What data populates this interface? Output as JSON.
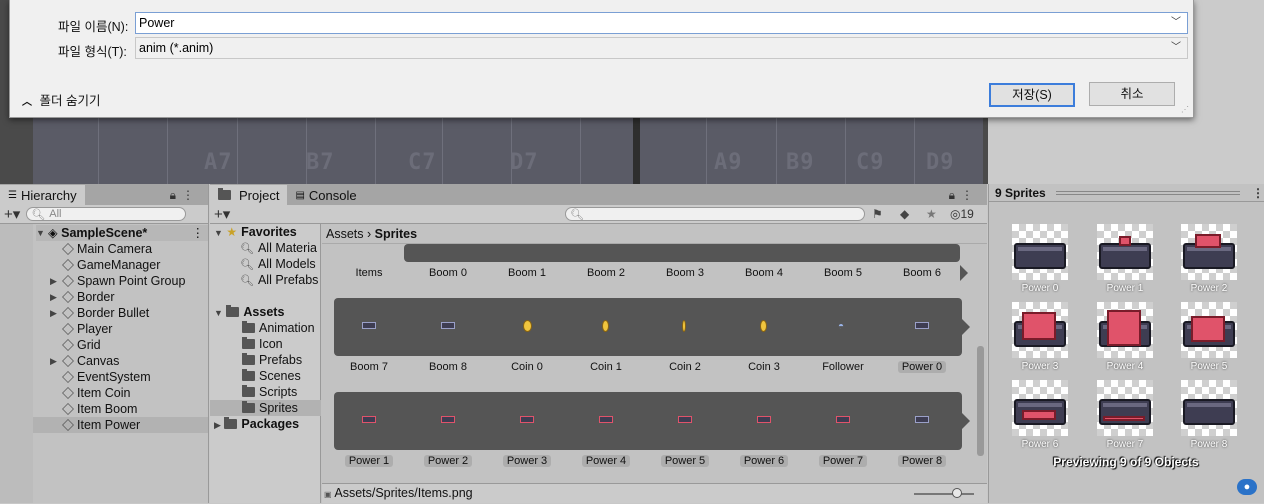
{
  "dialog": {
    "filename_label": "파일 이름(N):",
    "filename_value": "Power",
    "filetype_label": "파일 형식(T):",
    "filetype_value": "anim (*.anim)",
    "hide_folders": "폴더 숨기기",
    "save_button": "저장(S)",
    "cancel_button": "취소"
  },
  "scene": {
    "labels": [
      "A7",
      "B7",
      "C7",
      "D7",
      "A9",
      "B9",
      "C9",
      "D9"
    ]
  },
  "hierarchy": {
    "tab": "Hierarchy",
    "search_placeholder": "All",
    "scene_name": "SampleScene*",
    "items": [
      "Main Camera",
      "GameManager",
      "Spawn Point Group",
      "Border",
      "Border Bullet",
      "Player",
      "Grid",
      "Canvas",
      "EventSystem",
      "Item Coin",
      "Item Boom",
      "Item Power"
    ]
  },
  "project": {
    "tab_project": "Project",
    "tab_console": "Console",
    "badge_count": "19",
    "favorites": {
      "label": "Favorites",
      "items": [
        "All Materia",
        "All Models",
        "All Prefabs"
      ]
    },
    "assets": {
      "label": "Assets",
      "items": [
        "Animation",
        "Icon",
        "Prefabs",
        "Scenes",
        "Scripts",
        "Sprites"
      ]
    },
    "packages": "Packages",
    "breadcrumb_root": "Assets",
    "breadcrumb_current": "Sprites",
    "row1_labels": [
      "Items",
      "Boom 0",
      "Boom 1",
      "Boom 2",
      "Boom 3",
      "Boom 4",
      "Boom 5",
      "Boom 6"
    ],
    "row2_labels": [
      "Boom 7",
      "Boom 8",
      "Coin 0",
      "Coin 1",
      "Coin 2",
      "Coin 3",
      "Follower",
      "Power 0"
    ],
    "row3_labels": [
      "Power 1",
      "Power 2",
      "Power 3",
      "Power 4",
      "Power 5",
      "Power 6",
      "Power 7",
      "Power 8"
    ],
    "footer_path": "Assets/Sprites/Items.png"
  },
  "preview": {
    "header": "9 Sprites",
    "items": [
      "Power 0",
      "Power 1",
      "Power 2",
      "Power 3",
      "Power 4",
      "Power 5",
      "Power 6",
      "Power 7",
      "Power 8"
    ],
    "status": "Previewing 9 of 9 Objects"
  }
}
